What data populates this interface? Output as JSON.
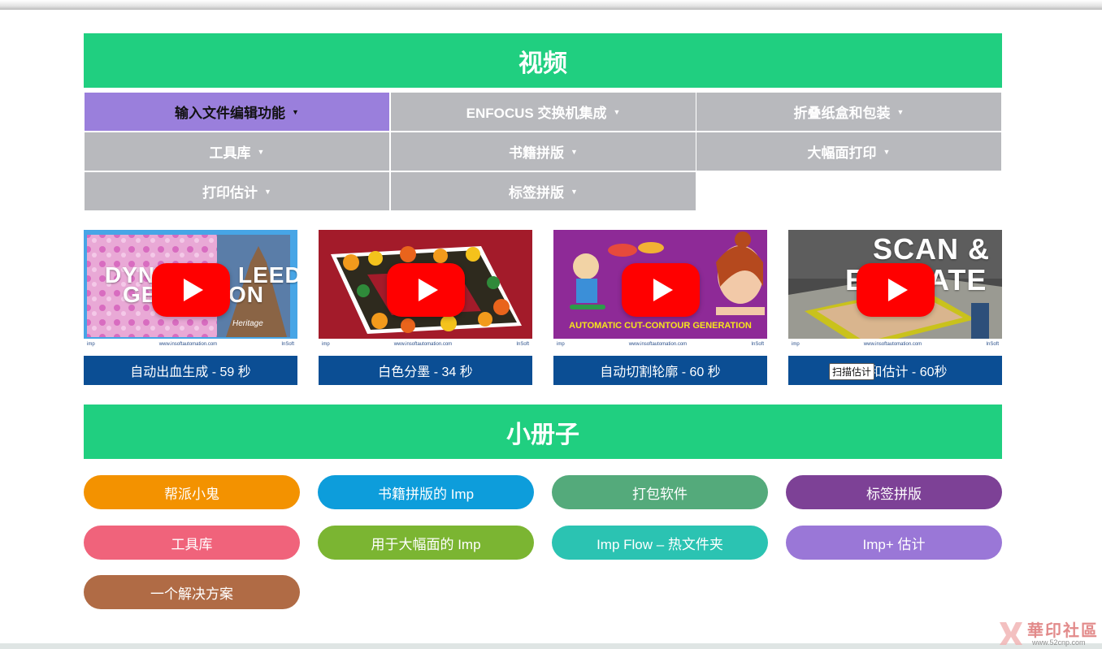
{
  "video_section": {
    "title": "视频"
  },
  "tabs": [
    {
      "label": "输入文件编辑功能",
      "active": true
    },
    {
      "label": "ENFOCUS 交换机集成",
      "active": false
    },
    {
      "label": "折叠纸盒和包装",
      "active": false
    },
    {
      "label": "工具库",
      "active": false
    },
    {
      "label": "书籍拼版",
      "active": false
    },
    {
      "label": "大幅面打印",
      "active": false
    },
    {
      "label": "打印估计",
      "active": false
    },
    {
      "label": "标签拼版",
      "active": false
    }
  ],
  "dropdown_icon": "caret-down-icon",
  "videos": [
    {
      "caption": "自动出血生成 - 59 秒",
      "thumb_text_1": "DYN",
      "thumb_text_2": "LEED",
      "thumb_text_3": "GE",
      "thumb_text_4": "ON",
      "thumb_text_5": "Heritage"
    },
    {
      "caption": "白色分墨 - 34 秒"
    },
    {
      "caption": "自动切割轮廓 - 60 秒",
      "banner": "AUTOMATIC CUT-CONTOUR GENERATION"
    },
    {
      "caption": "扫描和估计 - 60秒",
      "thumb_text_1": "SCAN &",
      "thumb_text_2": "E",
      "thumb_text_3": "ATE",
      "tooltip": "扫描估计"
    }
  ],
  "thumb_footer": {
    "logo": "imp",
    "url": "www.insoftautomation.com",
    "brand": "InSoft"
  },
  "play_icon": "youtube-play-icon",
  "brochure_section": {
    "title": "小册子"
  },
  "brochures": [
    {
      "label": "帮派小鬼",
      "color": "#f39200"
    },
    {
      "label": "书籍拼版的 Imp",
      "color": "#0d9ddb"
    },
    {
      "label": "打包软件",
      "color": "#54aa7b"
    },
    {
      "label": "标签拼版",
      "color": "#7d4196"
    },
    {
      "label": "工具库",
      "color": "#f0637b"
    },
    {
      "label": "用于大幅面的 Imp",
      "color": "#7bb532"
    },
    {
      "label": "Imp Flow – 热文件夹",
      "color": "#2bc3b2"
    },
    {
      "label": "Imp+ 估计",
      "color": "#9a77d7"
    },
    {
      "label": "一个解决方案",
      "color": "#b06b45"
    }
  ],
  "watermark": {
    "text": "華印社區",
    "url": "www.52cnp.com"
  },
  "colors": {
    "accent_green": "#20cf80",
    "tab_gray": "#b8b9bd",
    "tab_active": "#9a7fdc",
    "caption_blue": "#0b4e94",
    "youtube_red": "#ff0000"
  }
}
